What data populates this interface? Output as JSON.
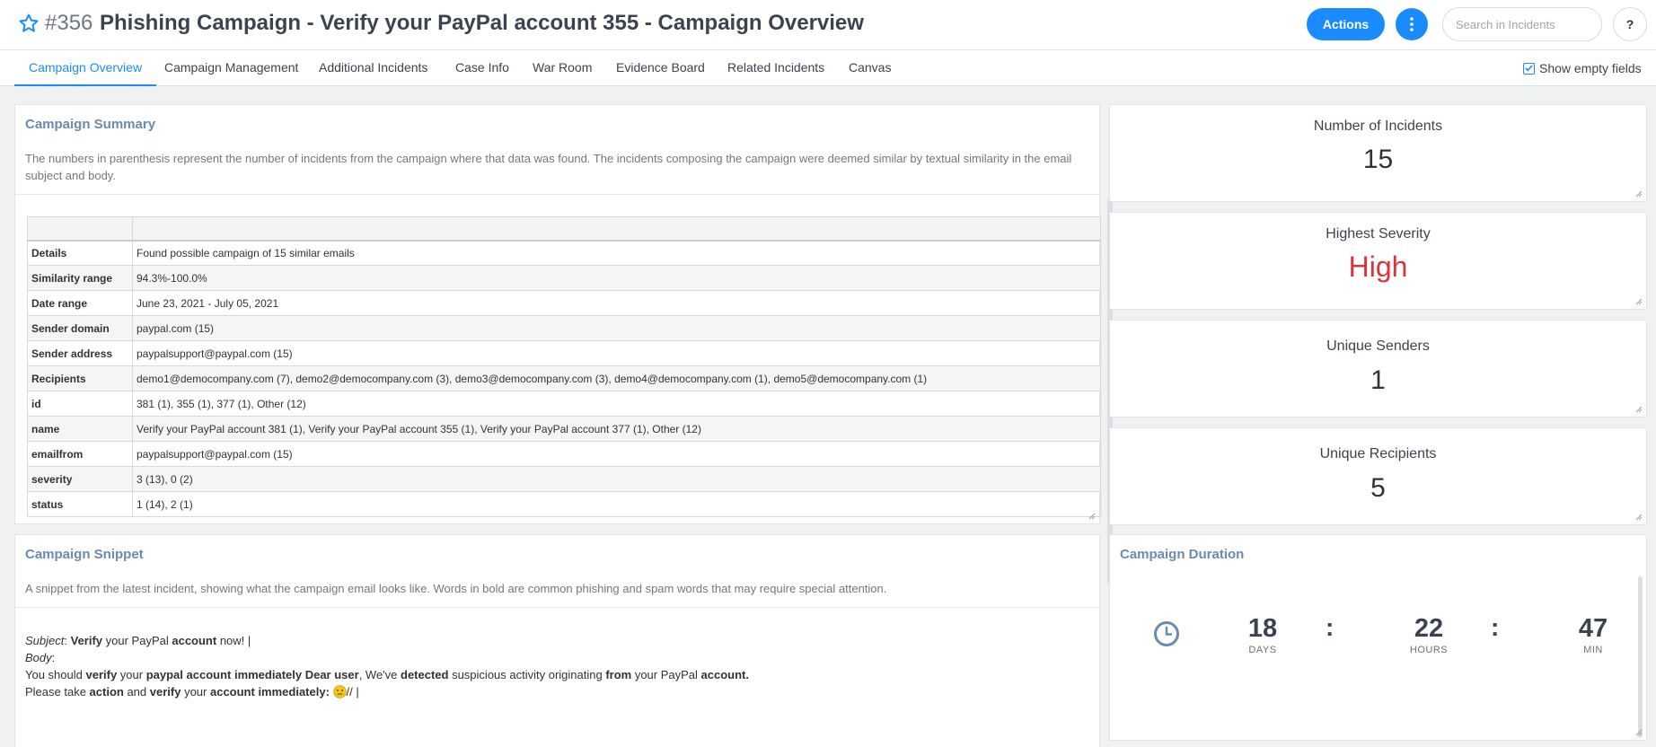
{
  "header": {
    "incident_number": "#356",
    "title": "Phishing Campaign - Verify your PayPal account 355 - Campaign Overview",
    "actions_label": "Actions",
    "search_placeholder": "Search in Incidents",
    "help_label": "?",
    "favorite_icon": "star-outline-icon",
    "more_icon": "vertical-ellipsis-icon",
    "accent_color": "#1a8cff"
  },
  "tabs": [
    {
      "label": "Campaign Overview",
      "active": true
    },
    {
      "label": "Campaign Management"
    },
    {
      "label": "Additional Incidents"
    },
    {
      "label": "Case Info"
    },
    {
      "label": "War Room"
    },
    {
      "label": "Evidence Board"
    },
    {
      "label": "Related Incidents"
    },
    {
      "label": "Canvas"
    }
  ],
  "show_empty_fields": {
    "label": "Show empty fields",
    "checked": true
  },
  "summary": {
    "title": "Campaign Summary",
    "description": "The numbers in parenthesis represent the number of incidents from the campaign where that data was found. The incidents composing the campaign were deemed similar by textual similarity in the email subject and body.",
    "rows": [
      [
        "Details",
        "Found possible campaign of 15 similar emails"
      ],
      [
        "Similarity range",
        "94.3%-100.0%"
      ],
      [
        "Date range",
        "June 23, 2021 - July 05, 2021"
      ],
      [
        "Sender domain",
        "paypal.com (15)"
      ],
      [
        "Sender address",
        "paypalsupport@paypal.com (15)"
      ],
      [
        "Recipients",
        "demo1@democompany.com (7), demo2@democompany.com (3), demo3@democompany.com (3), demo4@democompany.com (1), demo5@democompany.com (1)"
      ],
      [
        "id",
        "381 (1), 355 (1), 377 (1), Other (12)"
      ],
      [
        "name",
        "Verify your PayPal account 381 (1), Verify your PayPal account 355 (1), Verify your PayPal account 377 (1), Other (12)"
      ],
      [
        "emailfrom",
        "paypalsupport@paypal.com (15)"
      ],
      [
        "severity",
        "3 (13), 0 (2)"
      ],
      [
        "status",
        "1 (14), 2 (1)"
      ]
    ]
  },
  "kpis": {
    "incidents": {
      "label": "Number of Incidents",
      "value": "15"
    },
    "severity": {
      "label": "Highest Severity",
      "value": "High",
      "color": "#d9343a"
    },
    "senders": {
      "label": "Unique Senders",
      "value": "1"
    },
    "recipients": {
      "label": "Unique Recipients",
      "value": "5"
    }
  },
  "snippet": {
    "title": "Campaign Snippet",
    "description": "A snippet from the latest incident, showing what the campaign email looks like. Words in bold are common phishing and spam words that may require special attention.",
    "subject_label": "Subject",
    "body_label": "Body",
    "subject_parts": [
      {
        "t": "Verify",
        "b": true
      },
      {
        "t": " your PayPal "
      },
      {
        "t": "account",
        "b": true
      },
      {
        "t": " now! |"
      }
    ],
    "line1_parts": [
      {
        "t": "You should "
      },
      {
        "t": "verify",
        "b": true
      },
      {
        "t": " your "
      },
      {
        "t": "paypal account immediately Dear user",
        "b": true
      },
      {
        "t": ", We've "
      },
      {
        "t": "detected",
        "b": true
      },
      {
        "t": " suspicious activity originating "
      },
      {
        "t": "from",
        "b": true
      },
      {
        "t": " your PayPal "
      },
      {
        "t": "account.",
        "b": true
      }
    ],
    "line2_parts": [
      {
        "t": "Please take "
      },
      {
        "t": "action",
        "b": true
      },
      {
        "t": " and "
      },
      {
        "t": "verify",
        "b": true
      },
      {
        "t": " your "
      },
      {
        "t": "account immediately:",
        "b": true
      }
    ],
    "line2_tail": "// |",
    "emoji_icon": "confused-face-emoji-icon"
  },
  "duration": {
    "title": "Campaign Duration",
    "icon": "clock-icon",
    "days": "18",
    "days_label": "DAYS",
    "hours": "22",
    "hours_label": "HOURS",
    "mins": "47",
    "mins_label": "MIN",
    "separator": ":"
  }
}
